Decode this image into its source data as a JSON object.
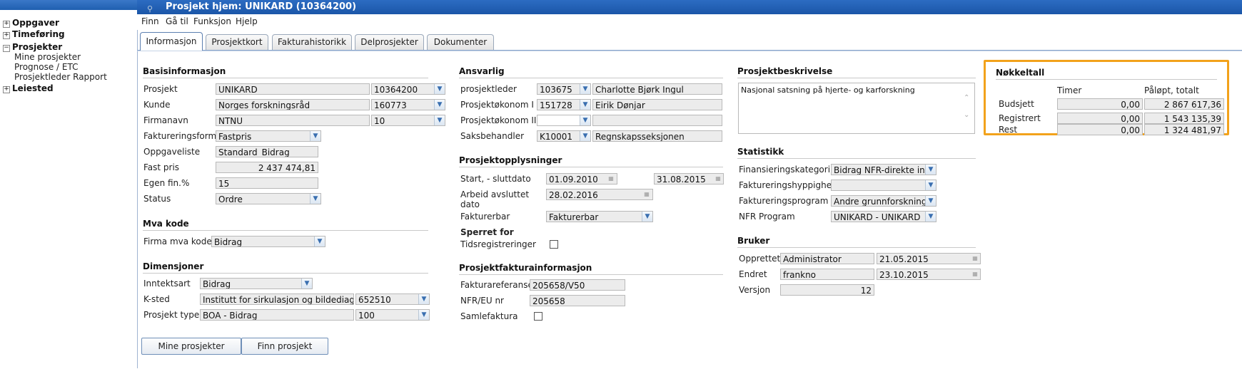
{
  "sidebar": {
    "groups": [
      {
        "label": "Oppgaver",
        "expander": "+"
      },
      {
        "label": "Timeføring",
        "expander": "+"
      },
      {
        "label": "Prosjekter",
        "expander": "−"
      },
      {
        "label": "Leiested",
        "expander": "+"
      }
    ],
    "prosjekter_items": [
      "Mine prosjekter",
      "Prognose / ETC",
      "Prosjektleder Rapport"
    ]
  },
  "header": {
    "title": "Prosjekt hjem: UNIKARD (10364200)",
    "search_icon": "magnifier-icon"
  },
  "menu": [
    "Finn",
    "Gå til",
    "Funksjon",
    "Hjelp"
  ],
  "tabs": [
    "Informasjon",
    "Prosjektkort",
    "Fakturahistorikk",
    "Delprosjekter",
    "Dokumenter"
  ],
  "basis": {
    "title": "Basisinformasjon",
    "prosjekt_label": "Prosjekt",
    "prosjekt_name": "UNIKARD",
    "prosjekt_id": "10364200",
    "kunde_label": "Kunde",
    "kunde_name": "Norges forskningsråd",
    "kunde_id": "160773",
    "firmanavn_label": "Firmanavn",
    "firmanavn_name": "NTNU",
    "firmanavn_id": "10",
    "faktform_label": "Faktureringsform",
    "faktform_value": "Fastpris",
    "oppgaveliste_label": "Oppgaveliste",
    "oppgaveliste_value": "Standard_Bidrag",
    "fastpris_label": "Fast pris",
    "fastpris_value": "2 437 474,81",
    "egenfin_label": "Egen fin.%",
    "egenfin_value": "15",
    "status_label": "Status",
    "status_value": "Ordre"
  },
  "mva": {
    "title": "Mva kode",
    "label": "Firma mva kode",
    "value": "Bidrag"
  },
  "dimensjoner": {
    "title": "Dimensjoner",
    "inntektsart_label": "Inntektsart",
    "inntektsart_value": "Bidrag",
    "ksted_label": "K-sted",
    "ksted_name": "Institutt for sirkulasjon og bildediagnostikk",
    "ksted_id": "652510",
    "prosjekttype_label": "Prosjekt type",
    "prosjekttype_name": "BOA - Bidrag",
    "prosjekttype_id": "100"
  },
  "buttons": {
    "mine": "Mine prosjekter",
    "finn": "Finn prosjekt"
  },
  "ansvarlig": {
    "title": "Ansvarlig",
    "prosjektleder_label": "prosjektleder",
    "prosjektleder_id": "103675",
    "prosjektleder_name": "Charlotte Bjørk Ingul",
    "okonom1_label": "Prosjektøkonom I",
    "okonom1_id": "151728",
    "okonom1_name": "Eirik Dønjar",
    "okonom2_label": "Prosjektøkonom II",
    "okonom2_id": "",
    "okonom2_name": "",
    "saksbehandler_label": "Saksbehandler",
    "saksbehandler_id": "K10001",
    "saksbehandler_name": "Regnskapsseksjonen"
  },
  "opplysninger": {
    "title": "Prosjektopplysninger",
    "start_label": "Start, - sluttdato",
    "start_value": "01.09.2010",
    "slutt_value": "31.08.2015",
    "arbeid_label_1": "Arbeid avsluttet",
    "arbeid_label_2": "dato",
    "arbeid_value": "28.02.2016",
    "fakturerbar_label": "Fakturerbar",
    "fakturerbar_value": "Fakturerbar",
    "sperret_title": "Sperret for",
    "tidsreg_label": "Tidsregistreringer"
  },
  "fakturainfo": {
    "title": "Prosjektfakturainformasjon",
    "ref_label": "Fakturareferanse",
    "ref_value": "205658/V50",
    "nfr_label": "NFR/EU nr",
    "nfr_value": "205658",
    "samle_label": "Samlefaktura"
  },
  "beskrivelse": {
    "title": "Prosjektbeskrivelse",
    "text": "Nasjonal satsning på hjerte- og karforskning"
  },
  "statistikk": {
    "title": "Statistikk",
    "finans_label": "Finansieringskategori",
    "finans_value": "Bidrag NFR-direkte innt",
    "hyppighet_label": "Faktureringshyppighet",
    "hyppighet_value": "",
    "program_label": "Faktureringsprogram",
    "program_value": "Andre grunnforskningsp",
    "nfr_label": "NFR Program",
    "nfr_value": "UNIKARD - UNIKARD"
  },
  "bruker": {
    "title": "Bruker",
    "opprettet_label": "Opprettet",
    "opprettet_user": "Administrator",
    "opprettet_date": "21.05.2015",
    "endret_label": "Endret",
    "endret_user": "frankno",
    "endret_date": "23.10.2015",
    "versjon_label": "Versjon",
    "versjon_value": "12"
  },
  "nokkeltall": {
    "title": "Nøkkeltall",
    "col_timer": "Timer",
    "col_palopt": "Påløpt, totalt",
    "rows": [
      {
        "label": "Budsjett",
        "timer": "0,00",
        "palopt": "2 867 617,36"
      },
      {
        "label": "Registrert",
        "timer": "0,00",
        "palopt": "1 543 135,39"
      },
      {
        "label": "Rest",
        "timer": "0,00",
        "palopt": "1 324 481,97"
      }
    ],
    "highlight_color": "#f2a21b"
  }
}
